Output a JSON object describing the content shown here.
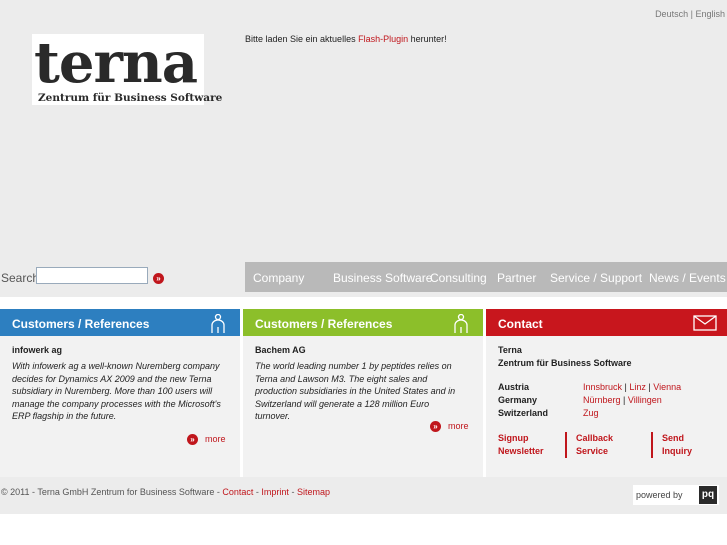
{
  "lang": {
    "de": "Deutsch",
    "sep": "|",
    "en": "English"
  },
  "logo": {
    "word": "terna",
    "sub": "Zentrum für Business Software"
  },
  "flash": {
    "before": "Bitte laden Sie ein aktuelles ",
    "link": "Flash-Plugin",
    "after": " herunter!"
  },
  "search": {
    "label": "Search",
    "value": "",
    "go_glyph": "»"
  },
  "nav": [
    "Company",
    "Business Software",
    "Consulting",
    "Partner",
    "Service / Support",
    "News / Events"
  ],
  "panels": {
    "ref1": {
      "heading": "Customers / References",
      "title": "infowerk ag",
      "text": "With infowerk ag a well-known Nuremberg company decides for Dynamics AX 2009 and the new Terna subsidiary in Nuremberg. More than 100 users will manage the company processes with the Microsoft's ERP flagship in the future.",
      "more": "more",
      "color": "#2d7fc0"
    },
    "ref2": {
      "heading": "Customers / References",
      "title": "Bachem AG",
      "text": "The world leading number 1 by peptides relies on Terna and Lawson M3. The eight sales and production subsidiaries in the United States and in Switzerland will generate a 128 million Euro turnover.",
      "more": "more",
      "color": "#8cbf2a"
    },
    "contact": {
      "heading": "Contact",
      "color": "#c8161d",
      "name": "Terna",
      "sub": "Zentrum für Business Software",
      "countries": [
        {
          "name": "Austria",
          "cities": [
            "Innsbruck",
            "Linz",
            "Vienna"
          ]
        },
        {
          "name": "Germany",
          "cities": [
            "Nürnberg",
            "Villingen"
          ]
        },
        {
          "name": "Switzerland",
          "cities": [
            "Zug"
          ]
        }
      ],
      "actions": [
        {
          "l1": "Signup",
          "l2": "Newsletter"
        },
        {
          "l1": "Callback",
          "l2": "Service"
        },
        {
          "l1": "Send",
          "l2": "Inquiry"
        }
      ]
    }
  },
  "footer": {
    "copyright": "© 2011 - Terna GmbH Zentrum for Business Software - ",
    "links": [
      "Contact",
      "Imprint",
      "Sitemap"
    ],
    "sep": " - ",
    "powered": "powered by",
    "pq": "pq"
  },
  "colors": {
    "accent": "#c0161c",
    "nav": "#b9b9b9",
    "background": "#ececec"
  }
}
